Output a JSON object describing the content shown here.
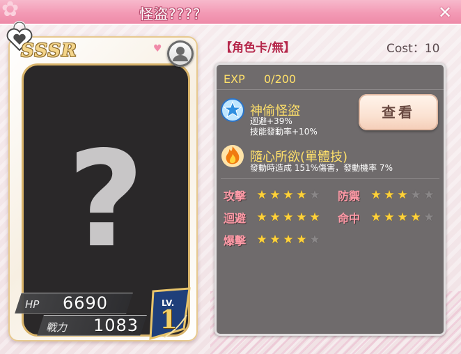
{
  "window": {
    "title": "怪盜????",
    "close_icon": "close-icon"
  },
  "card": {
    "rarity": "SSSR",
    "image_placeholder": "?",
    "hp_label": "HP",
    "hp_value": "6690",
    "power_label": "戰力",
    "power_value": "1083",
    "lv_label": "LV.",
    "lv_value": "1"
  },
  "header": {
    "card_type": "【角色卡/無】",
    "cost": "Cost：10"
  },
  "info": {
    "exp_label": "EXP",
    "exp_value": "0/200",
    "view_button": "查看",
    "skills": [
      {
        "name": "神偷怪盜",
        "icon": "star-badge-icon",
        "desc_lines": [
          "迴避+39%",
          "技能發動率+10%"
        ]
      },
      {
        "name": "隨心所欲(單體技)",
        "icon": "flame-icon",
        "desc_lines": [
          "發動時造成 151%傷害，發動機率 7%"
        ]
      }
    ],
    "attributes": [
      {
        "label": "攻擊",
        "stars": 4,
        "max": 5
      },
      {
        "label": "防禦",
        "stars": 3,
        "max": 5
      },
      {
        "label": "迴避",
        "stars": 5,
        "max": 5
      },
      {
        "label": "命中",
        "stars": 4,
        "max": 5
      },
      {
        "label": "爆擊",
        "stars": 4,
        "max": 5
      }
    ]
  },
  "colors": {
    "title_bar": "#f39ab5",
    "accent_red": "#b5264a",
    "gold_text": "#ffe06a",
    "attr_pink": "#ff9aa7",
    "panel_gray": "#6f6b6c"
  }
}
